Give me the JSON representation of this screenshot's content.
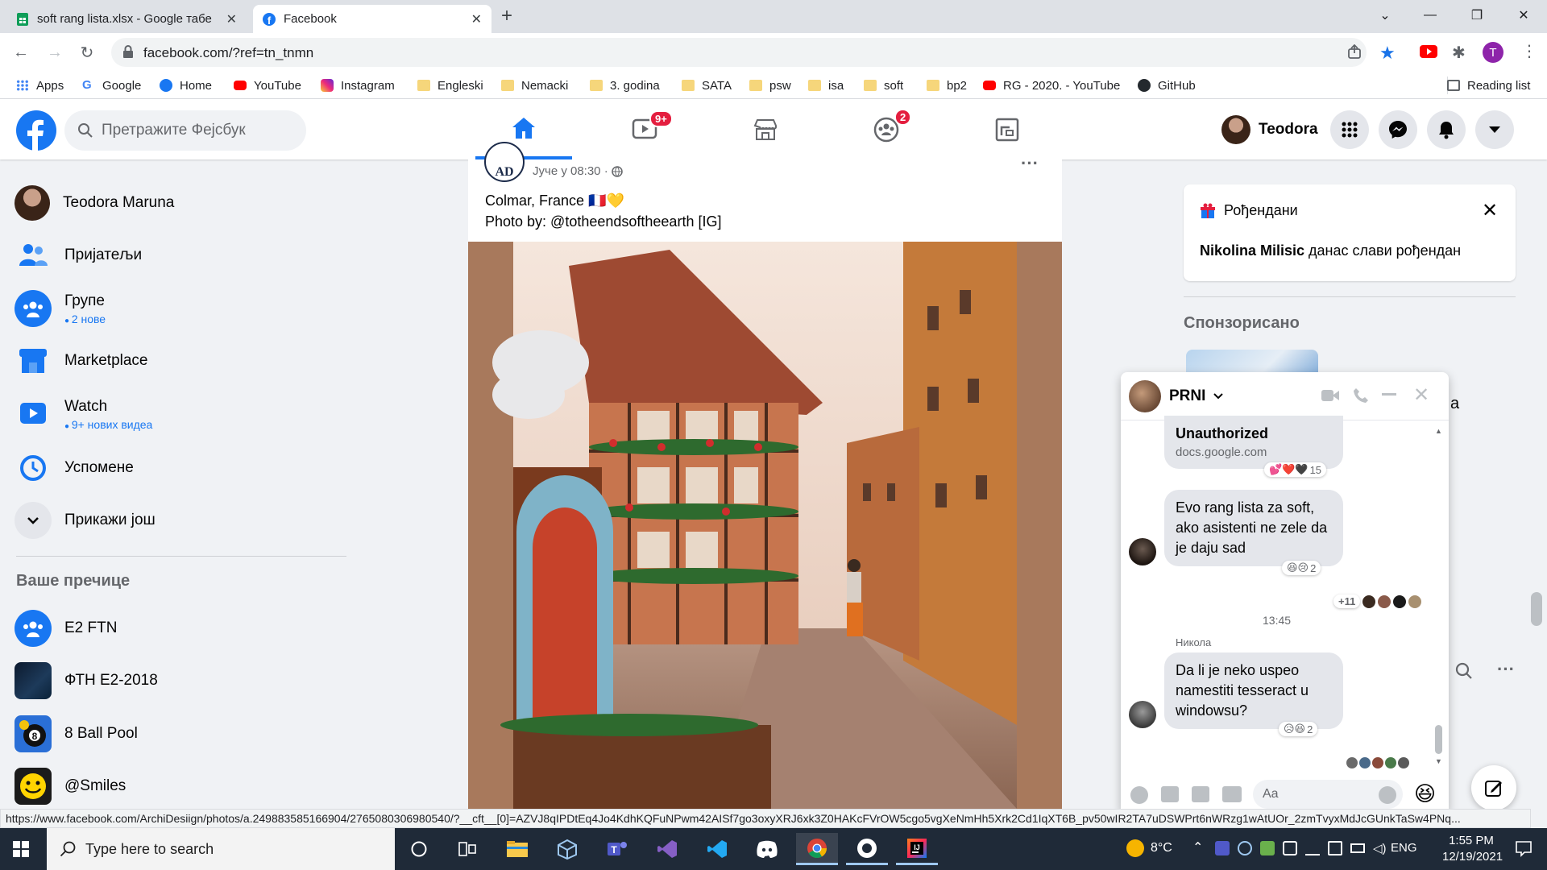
{
  "browser": {
    "tabs": [
      {
        "title": "soft rang lista.xlsx - Google табе",
        "close": "✕"
      },
      {
        "title": "Facebook",
        "close": "✕"
      }
    ],
    "new_tab": "+",
    "url": "facebook.com/?ref=tn_tnmn",
    "profile_initial": "T",
    "bookmarks": [
      {
        "label": "Apps"
      },
      {
        "label": "Google"
      },
      {
        "label": "Home"
      },
      {
        "label": "YouTube"
      },
      {
        "label": "Instagram"
      },
      {
        "label": "Engleski"
      },
      {
        "label": "Nemacki"
      },
      {
        "label": "3. godina"
      },
      {
        "label": "SATA"
      },
      {
        "label": "psw"
      },
      {
        "label": "isa"
      },
      {
        "label": "soft"
      },
      {
        "label": "bp2"
      },
      {
        "label": "RG - 2020. - YouTube"
      },
      {
        "label": "GitHub"
      }
    ],
    "reading_list": "Reading list",
    "status_url": "https://www.facebook.com/ArchiDesiign/photos/a.249883585166904/2765080306980540/?__cft__[0]=AZVJ8qIPDtEq4Jo4KdhKQFuNPwm42AISf7go3oxyXRJ6xk3Z0HAKcFVrOW5cgo5vgXeNmHh5Xrk2Cd1IqXT6B_pv50wIR2TA7uDSWPrt6nWRzg1wAtUOr_2zmTvyxMdJcGUnkTaSw4PNq..."
  },
  "facebook": {
    "search_placeholder": "Претражите Фејсбук",
    "nav_badges": {
      "watch": "9+",
      "groups": "2"
    },
    "user_name": "Teodora",
    "sidebar": [
      {
        "label": "Teodora Maruna",
        "sub": ""
      },
      {
        "label": "Пријатељи",
        "sub": ""
      },
      {
        "label": "Групе",
        "sub": "2 нове"
      },
      {
        "label": "Marketplace",
        "sub": ""
      },
      {
        "label": "Watch",
        "sub": "9+ нових видеа"
      },
      {
        "label": "Успомене",
        "sub": ""
      },
      {
        "label": "Прикажи још",
        "sub": ""
      }
    ],
    "shortcuts_title": "Ваше пречице",
    "shortcuts": [
      {
        "label": "E2 FTN"
      },
      {
        "label": "ФТН Е2-2018"
      },
      {
        "label": "8 Ball Pool"
      },
      {
        "label": "@Smiles"
      }
    ],
    "post": {
      "time": "Јуче у 08:30 ·",
      "line1": "Colmar, France 🇫🇷💛",
      "line2": "Photo by: @totheendsoftheearth [IG]",
      "more": "···"
    },
    "birthdays": {
      "title": "Рођендани",
      "name": "Nikolina Milisic",
      "text": " данас слави рођендан"
    },
    "sponsored": "Спонзорисано"
  },
  "chat": {
    "name": "PRNI",
    "link_title": "Unauthorized",
    "link_domain": "docs.google.com",
    "react1_count": "15",
    "msg1": "Evo rang lista za soft, ako asistenti ne zele da je daju sad",
    "react2_count": "2",
    "seen_more": "+11",
    "time": "13:45",
    "sender": "Никола",
    "msg2": "Da li je neko uspeo namestiti tesseract u windowsu?",
    "react3_count": "2",
    "input_placeholder": "Aa"
  },
  "taskbar": {
    "search": "Type here to search",
    "temp": "8°C",
    "lang": "ENG",
    "time": "1:55 PM",
    "date": "12/19/2021"
  },
  "colors": {
    "fb_blue": "#1877f2",
    "badge_red": "#e41e3f"
  }
}
